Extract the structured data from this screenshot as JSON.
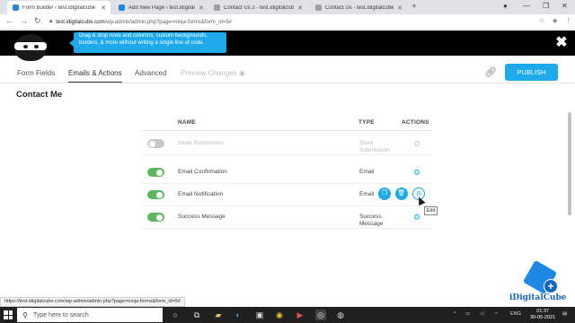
{
  "browser": {
    "tabs": [
      {
        "title": "Form Builder ‹ test.idigitalcube –",
        "active": true,
        "favicon_color": "#1e88e5"
      },
      {
        "title": "Add New Page ‹ test.idigitalcube –",
        "active": false,
        "favicon_color": "#1e88e5"
      },
      {
        "title": "Contact Us 2 - test.idigitalcube",
        "active": false,
        "favicon_color": "#5f6368"
      },
      {
        "title": "Contact Us - test.idigitalcube",
        "active": false,
        "favicon_color": "#5f6368"
      }
    ],
    "new_tab": "+",
    "url_domain": "test.idigitalcube.com",
    "url_path": "/wp-admin/admin.php?page=ninja-forms&form_id=5#",
    "window_controls": [
      "—",
      "❐",
      "✕"
    ]
  },
  "header": {
    "info_text": "Drag & drop rows and columns, custom backgrounds, borders, & more without writing a single line of code.",
    "close": "✖"
  },
  "nav": {
    "form_fields": "Form Fields",
    "emails_actions": "Emails & Actions",
    "advanced": "Advanced",
    "preview": "Preview Changes",
    "publish": "PUBLISH"
  },
  "page_title": "Contact Me",
  "table": {
    "headers": {
      "name": "NAME",
      "type": "TYPE",
      "actions": "ACTIONS"
    },
    "rows": [
      {
        "name": "Store Submission",
        "type": "Store Submission",
        "enabled": false
      },
      {
        "name": "Email Confirmation",
        "type": "Email",
        "enabled": true
      },
      {
        "name": "Email Notification",
        "type": "Email",
        "enabled": true
      },
      {
        "name": "Success Message",
        "type": "Success Message",
        "enabled": true
      }
    ],
    "edit_tooltip": "Edit"
  },
  "status_url": "https://test.idigitalcube.com/wp-admin/admin.php?page=ninja-forms&form_id=5#",
  "logo_text": "iDigitalCube",
  "taskbar": {
    "search_placeholder": "Type here to search",
    "lang": "ENG",
    "time": "01:37",
    "date": "30-05-2021"
  },
  "colors": {
    "accent": "#1ea9ea",
    "toggle_on": "#5cb85c",
    "header_bg": "#000000"
  }
}
